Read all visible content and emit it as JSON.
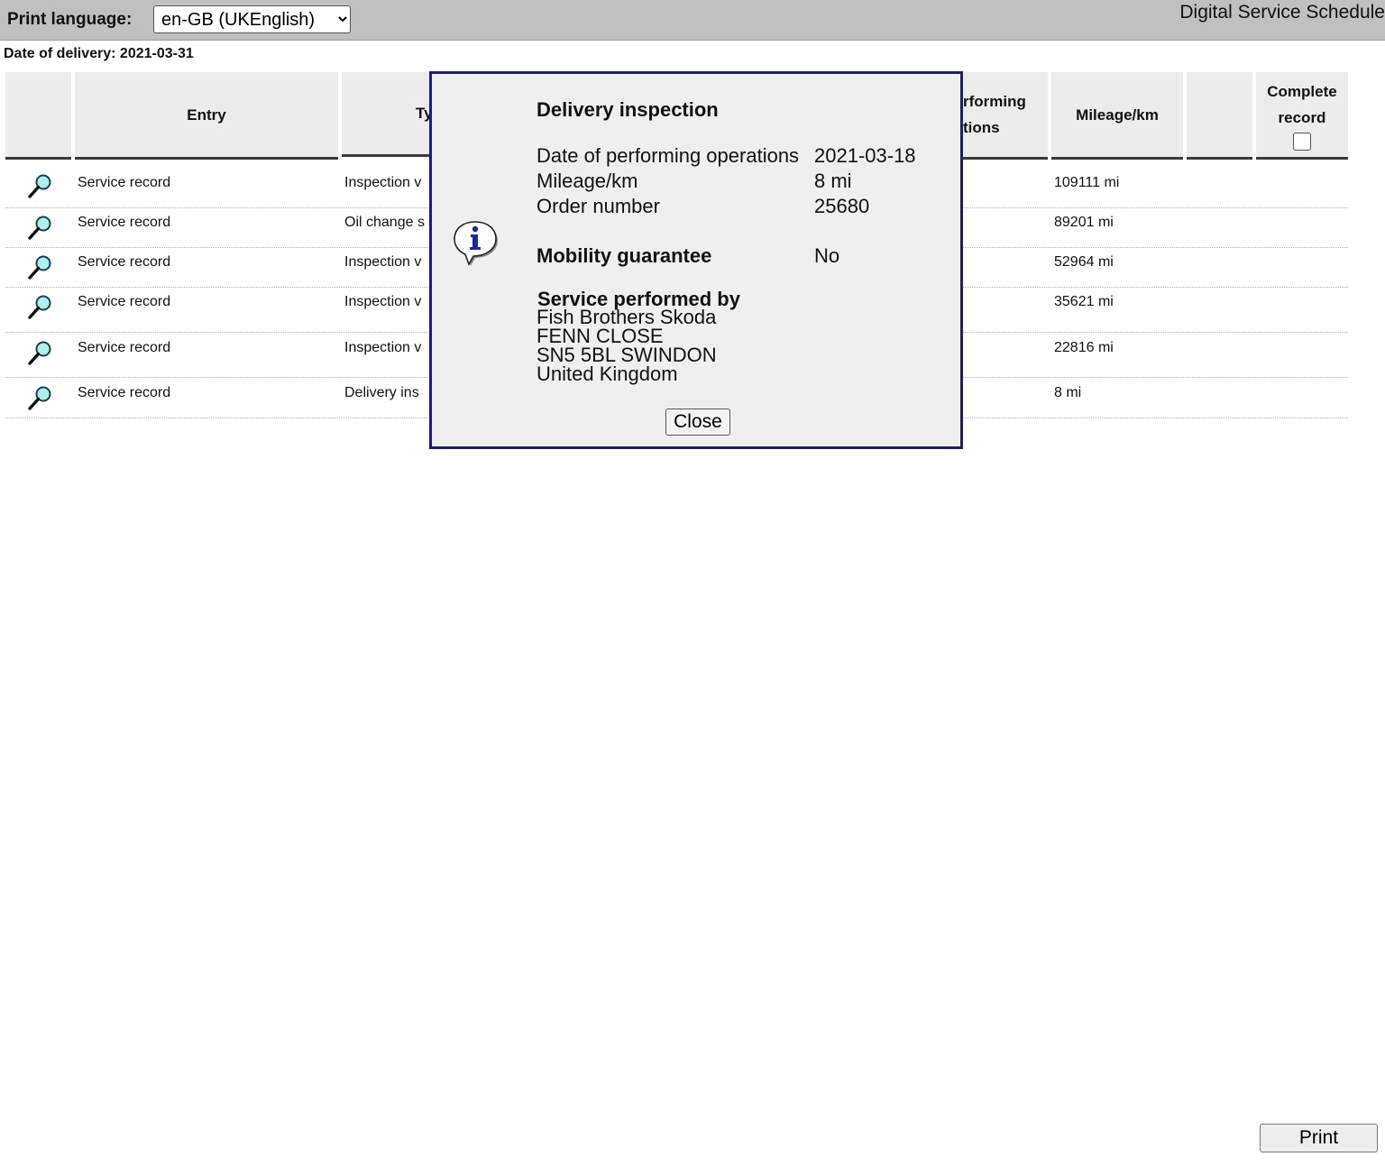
{
  "header": {
    "print_language_label": "Print language:",
    "print_language_value": "en-GB (UKEnglish)",
    "app_title": "Digital Service Schedule"
  },
  "delivery_date": "Date of delivery: 2021-03-31",
  "table": {
    "headers": {
      "entry": "Entry",
      "type": "Ty",
      "performing": "rforming",
      "performing_2": "tions",
      "mileage": "Mileage/km",
      "complete_1": "Complete",
      "complete_2": "record"
    },
    "rows": [
      {
        "entry": "Service record",
        "type": "Inspection v",
        "mileage": "109111 mi"
      },
      {
        "entry": "Service record",
        "type": "Oil change s",
        "mileage": "89201 mi"
      },
      {
        "entry": "Service record",
        "type": "Inspection v",
        "mileage": "52964 mi"
      },
      {
        "entry": "Service record",
        "type": "Inspection v",
        "mileage": "35621 mi"
      },
      {
        "entry": "Service record",
        "type": "Inspection v",
        "mileage": "22816 mi"
      },
      {
        "entry": "Service record",
        "type": "Delivery ins",
        "mileage": "8 mi"
      }
    ]
  },
  "modal": {
    "title": "Delivery inspection",
    "date_label": "Date of performing operations",
    "date_value": "2021-03-18",
    "mileage_label": "Mileage/km",
    "mileage_value": "8 mi",
    "order_label": "Order number",
    "order_value": "25680",
    "mobility_label": "Mobility guarantee",
    "mobility_value": "No",
    "service_by_label": "Service performed by",
    "address": [
      "Fish Brothers Skoda",
      "FENN CLOSE",
      "SN5 5BL SWINDON",
      "United Kingdom"
    ],
    "close_label": "Close"
  },
  "print_label": "Print",
  "icons": {
    "magnifier": "magnifier-icon",
    "info": "info-icon"
  }
}
